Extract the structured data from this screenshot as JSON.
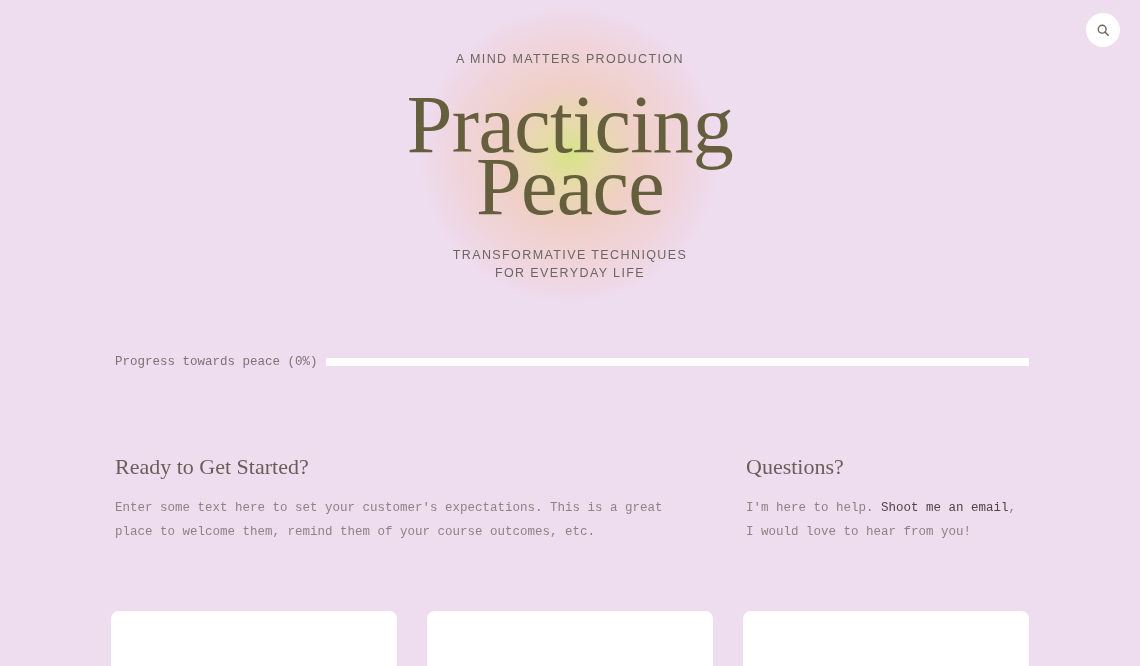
{
  "hero": {
    "eyebrow": "A MIND MATTERS PRODUCTION",
    "title": "Practicing Peace",
    "tagline": "TRANSFORMATIVE TECHNIQUES FOR EVERYDAY LIFE"
  },
  "progress": {
    "label": "Progress towards peace (0%)",
    "level": 0
  },
  "sections": [
    {
      "kind": "intro",
      "heading": "Ready to Get Started?",
      "text": "Enter some text here to set your customer's expectations. This is a great place to welcome them, remind them of your course outcomes, etc."
    },
    {
      "kind": "contact",
      "heading": "Questions?",
      "text_before": "I'm here to help.",
      "link": "Shoot me an email",
      "text_after": ", I would love to hear from you!"
    }
  ],
  "cards": [
    {
      "kind": "blank"
    },
    {
      "kind": "blank"
    },
    {
      "kind": "blank"
    }
  ]
}
